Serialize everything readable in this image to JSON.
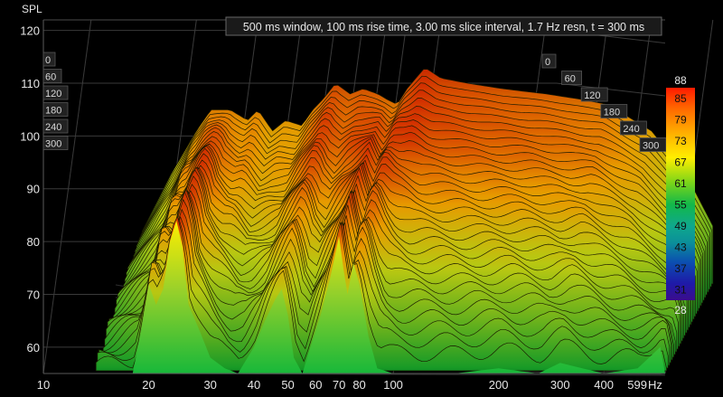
{
  "chart_data": {
    "type": "area",
    "description_label": "waterfall",
    "ylabel": "SPL",
    "xunit": "Hz",
    "header": "500 ms window, 100 ms rise time, 3.00 ms slice interval, 1.7 Hz resn, t = 300 ms",
    "ylim": [
      55,
      122
    ],
    "y_ticks": [
      60,
      70,
      80,
      90,
      100,
      110,
      120
    ],
    "xlim": [
      10,
      599
    ],
    "x_scale": "log",
    "x_ticks": [
      {
        "v": 10,
        "label": "10"
      },
      {
        "v": 20,
        "label": "20"
      },
      {
        "v": 30,
        "label": "30"
      },
      {
        "v": 40,
        "label": "40"
      },
      {
        "v": 50,
        "label": "50"
      },
      {
        "v": 60,
        "label": "60"
      },
      {
        "v": 70,
        "label": "70"
      },
      {
        "v": 80,
        "label": "80"
      },
      {
        "v": 100,
        "label": "100"
      },
      {
        "v": 200,
        "label": "200"
      },
      {
        "v": 300,
        "label": "300"
      },
      {
        "v": 400,
        "label": "400"
      },
      {
        "v": 599,
        "label": "599"
      }
    ],
    "time_slices_ms": [
      0,
      60,
      120,
      180,
      240,
      300
    ],
    "colorbar": {
      "min": 28,
      "max": 88,
      "ticks": [
        85,
        79,
        73,
        67,
        61,
        55,
        49,
        43,
        37,
        31
      ],
      "min_label": "28",
      "max_label": "88"
    },
    "series_front": {
      "name": "t = 300 ms",
      "freq_hz": [
        18,
        19,
        20,
        21,
        22,
        23,
        24,
        25,
        26,
        28,
        30,
        33,
        36,
        40,
        43,
        46,
        48,
        50,
        52,
        55,
        58,
        62,
        66,
        70,
        72,
        74,
        77,
        80,
        85,
        90,
        100,
        120,
        150,
        200,
        260,
        300,
        400,
        500,
        580,
        599
      ],
      "spl_db": [
        55,
        63,
        72,
        68,
        71,
        80,
        84,
        79,
        68,
        63,
        58,
        56,
        55,
        60,
        65,
        69,
        71,
        66,
        58,
        55,
        60,
        66,
        73,
        81,
        75,
        70,
        76,
        72,
        62,
        56,
        55,
        55,
        55,
        56,
        55,
        57,
        55,
        56,
        60,
        55
      ]
    },
    "series_envelope": {
      "name": "t = 0 ms",
      "freq_hz": [
        14,
        17,
        20,
        22,
        25,
        28,
        30,
        33,
        36,
        40,
        43,
        46,
        50,
        55,
        60,
        66,
        70,
        75,
        80,
        90,
        100,
        120,
        150,
        200,
        250,
        300,
        400,
        500,
        599
      ],
      "spl_db": [
        65,
        76,
        84,
        88,
        88,
        86,
        88,
        84,
        86,
        85,
        88,
        90,
        93,
        91,
        92,
        91,
        90,
        89,
        92,
        96,
        94,
        93,
        92,
        91,
        90,
        89,
        84,
        76,
        66
      ]
    }
  }
}
